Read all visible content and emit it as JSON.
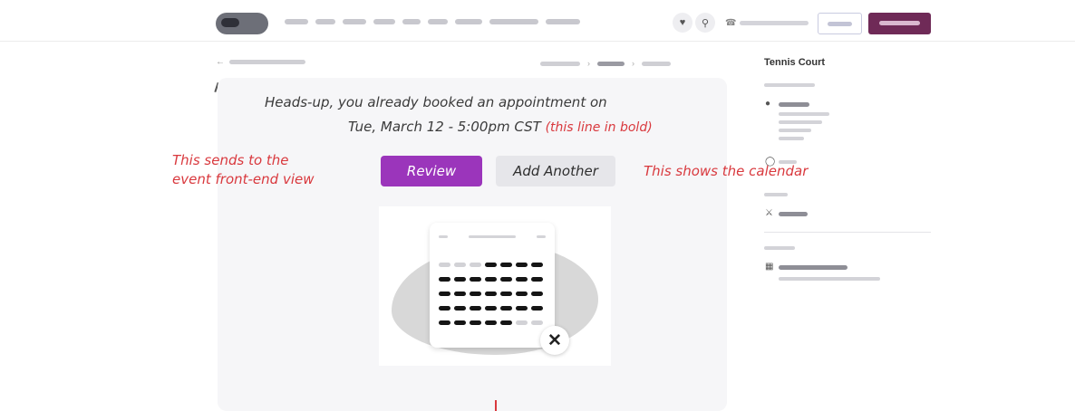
{
  "header": {
    "nav_count": 10,
    "phone_icon": "phone-icon",
    "icons": [
      "heart-icon",
      "search-icon",
      "phone-icon"
    ]
  },
  "booking": {
    "message_line1": "Heads-up, you already booked an appointment on",
    "message_line2": "Tue, March 12 - 5:00pm CST",
    "bold_note": "(this line in bold)",
    "review_label": "Review",
    "add_another_label": "Add Another",
    "note_left_line1": "This sends to the",
    "note_left_line2": "event front-end view",
    "note_right": "This shows the calendar",
    "close_glyph": "✕"
  },
  "sidebar": {
    "title": "Tennis Court"
  },
  "colors": {
    "accent_purple": "#9b35bb",
    "brand_plum": "#6f2a57",
    "annotation_red": "#d9393e"
  }
}
